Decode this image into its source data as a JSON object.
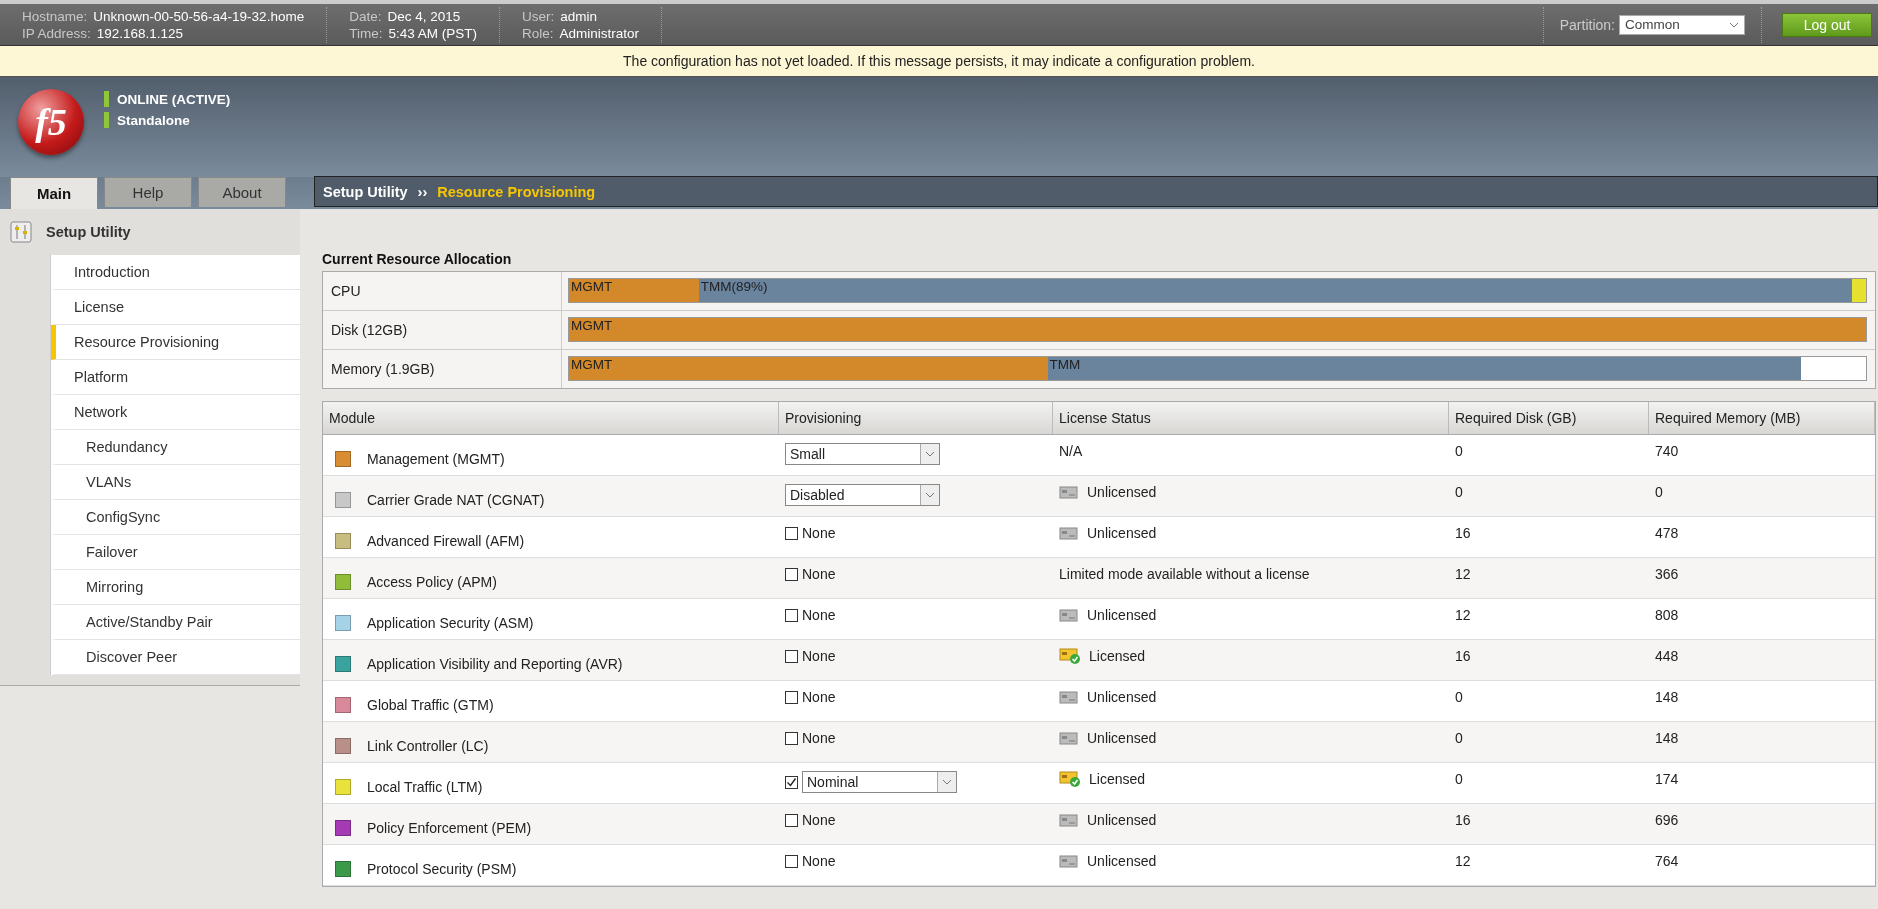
{
  "top_bar": {
    "info_groups": [
      {
        "rows": [
          {
            "label": "Hostname:",
            "value": "Unknown-00-50-56-a4-19-32.home"
          },
          {
            "label": "IP Address:",
            "value": "192.168.1.125"
          }
        ]
      },
      {
        "rows": [
          {
            "label": "Date:",
            "value": "Dec 4, 2015"
          },
          {
            "label": "Time:",
            "value": "5:43 AM (PST)"
          }
        ]
      },
      {
        "rows": [
          {
            "label": "User:",
            "value": "admin"
          },
          {
            "label": "Role:",
            "value": "Administrator"
          }
        ]
      }
    ],
    "partition": {
      "label": "Partition:",
      "value": "Common"
    },
    "logout_button": "Log out"
  },
  "notice": "The configuration has not yet loaded. If this message persists, it may indicate a configuration problem.",
  "banner": {
    "logo": "f5",
    "statuses": [
      "ONLINE (ACTIVE)",
      "Standalone"
    ]
  },
  "tabs": [
    {
      "label": "Main",
      "selected": true
    },
    {
      "label": "Help",
      "selected": false
    },
    {
      "label": "About",
      "selected": false
    }
  ],
  "breadcrumb": {
    "parent": "Setup Utility",
    "separator": "››",
    "current": "Resource Provisioning"
  },
  "sidebar": {
    "title": "Setup Utility",
    "items": [
      {
        "label": "Introduction",
        "selected": false
      },
      {
        "label": "License",
        "selected": false
      },
      {
        "label": "Resource Provisioning",
        "selected": true
      },
      {
        "label": "Platform",
        "selected": false
      },
      {
        "label": "Network",
        "selected": false,
        "children": [
          {
            "label": "Redundancy",
            "selected": false
          },
          {
            "label": "VLANs",
            "selected": false
          },
          {
            "label": "ConfigSync",
            "selected": false
          },
          {
            "label": "Failover",
            "selected": false
          },
          {
            "label": "Mirroring",
            "selected": false
          },
          {
            "label": "Active/Standby Pair",
            "selected": false
          },
          {
            "label": "Discover Peer",
            "selected": false
          }
        ]
      }
    ]
  },
  "allocation": {
    "title": "Current Resource Allocation",
    "resources": [
      {
        "name": "CPU",
        "segments": [
          {
            "label": "MGMT",
            "level": 0.1,
            "color": "#d3892a"
          },
          {
            "label": "TMM(89%)",
            "level": 0.989,
            "color": "#6a849e"
          },
          {
            "level": 1,
            "color": "#e6e02e"
          }
        ]
      },
      {
        "name": "Disk (12GB)",
        "segments": [
          {
            "label": "MGMT",
            "level": 1,
            "color": "#d3892a"
          }
        ]
      },
      {
        "name": "Memory (1.9GB)",
        "segments": [
          {
            "label": "MGMT",
            "level": 0.369,
            "color": "#d3892a"
          },
          {
            "label": "TMM",
            "level": 0.95,
            "color": "#6a849e"
          }
        ]
      }
    ]
  },
  "modules": {
    "columns": [
      "Module",
      "Provisioning",
      "License Status",
      "Required Disk (GB)",
      "Required Memory (MB)"
    ],
    "rows": [
      {
        "name": "Management (MGMT)",
        "color": "#d88d33",
        "provisioning": {
          "kind": "select",
          "value": "Small"
        },
        "license": {
          "kind": "text",
          "text": "N/A"
        },
        "disk": "0",
        "memory": "740"
      },
      {
        "name": "Carrier Grade NAT (CGNAT)",
        "color": "#c8c8c8",
        "provisioning": {
          "kind": "select",
          "value": "Disabled"
        },
        "license": {
          "kind": "unlicensed",
          "text": "Unlicensed"
        },
        "disk": "0",
        "memory": "0"
      },
      {
        "name": "Advanced Firewall (AFM)",
        "color": "#c8bd7e",
        "provisioning": {
          "kind": "checkbox",
          "checked": false,
          "label": "None"
        },
        "license": {
          "kind": "unlicensed",
          "text": "Unlicensed"
        },
        "disk": "16",
        "memory": "478"
      },
      {
        "name": "Access Policy (APM)",
        "color": "#8fbd3a",
        "provisioning": {
          "kind": "checkbox",
          "checked": false,
          "label": "None"
        },
        "license": {
          "kind": "text",
          "text": "Limited mode available without a license"
        },
        "disk": "12",
        "memory": "366"
      },
      {
        "name": "Application Security (ASM)",
        "color": "#a6d2e8",
        "provisioning": {
          "kind": "checkbox",
          "checked": false,
          "label": "None"
        },
        "license": {
          "kind": "unlicensed",
          "text": "Unlicensed"
        },
        "disk": "12",
        "memory": "808"
      },
      {
        "name": "Application Visibility and Reporting (AVR)",
        "color": "#3aa39e",
        "provisioning": {
          "kind": "checkbox",
          "checked": false,
          "label": "None"
        },
        "license": {
          "kind": "licensed",
          "text": "Licensed"
        },
        "disk": "16",
        "memory": "448"
      },
      {
        "name": "Global Traffic (GTM)",
        "color": "#d88a9a",
        "provisioning": {
          "kind": "checkbox",
          "checked": false,
          "label": "None"
        },
        "license": {
          "kind": "unlicensed",
          "text": "Unlicensed"
        },
        "disk": "0",
        "memory": "148"
      },
      {
        "name": "Link Controller (LC)",
        "color": "#b99088",
        "provisioning": {
          "kind": "checkbox",
          "checked": false,
          "label": "None"
        },
        "license": {
          "kind": "unlicensed",
          "text": "Unlicensed"
        },
        "disk": "0",
        "memory": "148"
      },
      {
        "name": "Local Traffic (LTM)",
        "color": "#e8e23a",
        "provisioning": {
          "kind": "checkbox-select",
          "checked": true,
          "value": "Nominal"
        },
        "license": {
          "kind": "licensed",
          "text": "Licensed"
        },
        "disk": "0",
        "memory": "174"
      },
      {
        "name": "Policy Enforcement (PEM)",
        "color": "#a63ab5",
        "provisioning": {
          "kind": "checkbox",
          "checked": false,
          "label": "None"
        },
        "license": {
          "kind": "unlicensed",
          "text": "Unlicensed"
        },
        "disk": "16",
        "memory": "696"
      },
      {
        "name": "Protocol Security (PSM)",
        "color": "#3a9a4a",
        "provisioning": {
          "kind": "checkbox",
          "checked": false,
          "label": "None"
        },
        "license": {
          "kind": "unlicensed",
          "text": "Unlicensed"
        },
        "disk": "12",
        "memory": "764"
      }
    ]
  }
}
